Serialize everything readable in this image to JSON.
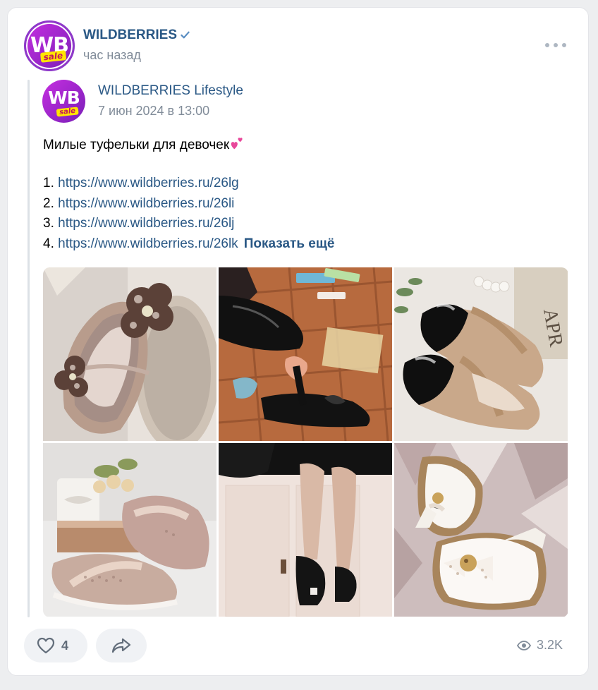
{
  "post": {
    "author": "WILDBERRIES",
    "time": "час назад",
    "logo_text": "WB",
    "logo_sale": "sale"
  },
  "repost": {
    "author": "WILDBERRIES Lifestyle",
    "date": "7 июн 2024 в 13:00",
    "text_line": "Милые туфельки для девочек",
    "links": [
      {
        "num": "1.",
        "url": "https://www.wildberries.ru/26lg"
      },
      {
        "num": "2.",
        "url": "https://www.wildberries.ru/26li"
      },
      {
        "num": "3.",
        "url": "https://www.wildberries.ru/26lj"
      },
      {
        "num": "4.",
        "url": "https://www.wildberries.ru/26lk"
      }
    ],
    "show_more": "Показать ещё"
  },
  "photos": [
    {
      "name": "photo-beige-shoes-houndstooth-flower"
    },
    {
      "name": "photo-black-shoes-on-pavement"
    },
    {
      "name": "photo-black-beige-patent-shoes"
    },
    {
      "name": "photo-rose-gold-perforated-shoes"
    },
    {
      "name": "photo-black-mary-jane-on-legs"
    },
    {
      "name": "photo-white-shoes-bow"
    }
  ],
  "footer": {
    "likes": "4",
    "views": "3.2K"
  },
  "icons": {
    "verified": "verified-check-icon",
    "more": "more-dots-icon",
    "like": "heart-icon",
    "share": "share-arrow-icon",
    "views": "eye-icon"
  },
  "colors": {
    "link": "#2a5885",
    "secondary": "#818c99",
    "brand_gradient_start": "#c52ee0",
    "brand_gradient_end": "#7a1fb8"
  }
}
